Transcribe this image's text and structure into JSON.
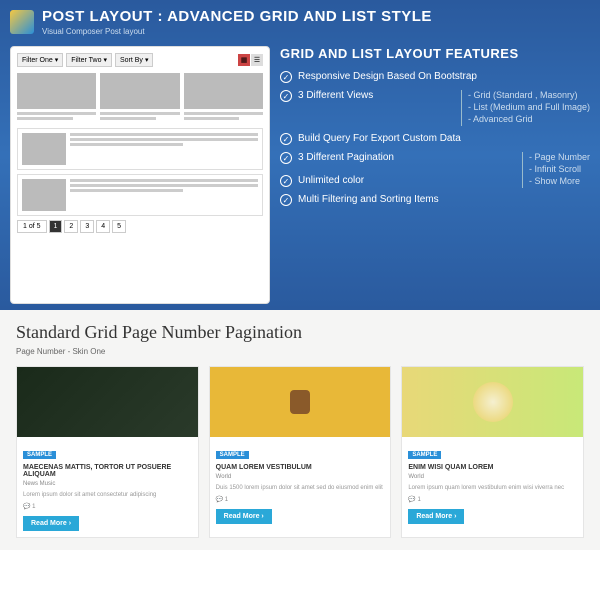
{
  "banner": {
    "title": "POST LAYOUT : ADVANCED GRID AND LIST STYLE",
    "subtitle": "Visual Composer Post layout"
  },
  "filters": {
    "f1": "Filter One",
    "f2": "Filter Two",
    "sort": "Sort By"
  },
  "pagination": {
    "info": "1 of 5",
    "p1": "1",
    "p2": "2",
    "p3": "3",
    "p4": "4",
    "p5": "5"
  },
  "features": {
    "title": "GRID AND LIST LAYOUT FEATURES",
    "f1": "Responsive Design Based On Bootstrap",
    "f2": "3 Different Views",
    "f2a": "Grid (Standard , Masonry)",
    "f2b": "List (Medium and Full Image)",
    "f2c": "Advanced Grid",
    "f3": "Build Query For Export Custom Data",
    "f4": "3 Different Pagination",
    "f4a": "Page Number",
    "f4b": "Infinit Scroll",
    "f4c": "Show More",
    "f5": "Unlimited color",
    "f6": "Multi Filtering and Sorting Items"
  },
  "section": {
    "title": "Standard Grid Page Number Pagination",
    "subtitle": "Page Number - Skin One"
  },
  "cards": {
    "badge": "SAMPLE",
    "read": "Read More ›",
    "c1": {
      "title": "MAECENAS MATTIS, TORTOR UT POSUERE ALIQUAM",
      "meta": "News    Music",
      "desc": "Lorem ipsum dolor sit amet consectetur adipiscing"
    },
    "c2": {
      "title": "QUAM LOREM VESTIBULUM",
      "meta": "World",
      "desc": "Duis 1500 lorem ipsum dolor sit amet sed do eiusmod enim elit"
    },
    "c3": {
      "title": "ENIM WISI QUAM LOREM",
      "meta": "World",
      "desc": "Lorem ipsum quam lorem vestibulum enim wisi viverra nec"
    }
  }
}
